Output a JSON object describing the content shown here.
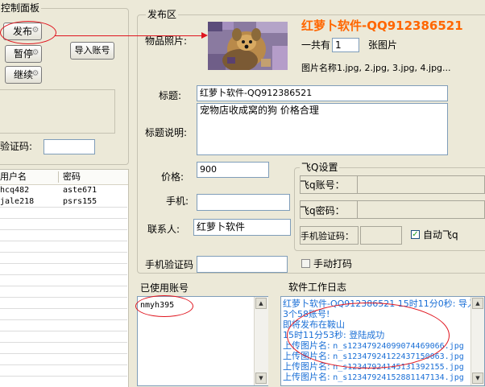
{
  "left_panel": {
    "title": "控制面板",
    "publish_button": "发布",
    "pause_button": "暂停",
    "continue_button": "继续",
    "import_button": "导入账号",
    "captcha_label": "验证码:",
    "captcha_value": ""
  },
  "accounts_table": {
    "headers": [
      "用户名",
      "密码"
    ],
    "rows": [
      {
        "user": "hcq482",
        "pass": "aste671"
      },
      {
        "user": "jale218",
        "pass": "psrs155"
      }
    ]
  },
  "publish": {
    "group_title": "发布区",
    "photo_label": "物品照片:",
    "brand_title": "红萝卜软件-QQ912386521",
    "count_prefix": "一共有",
    "count_value": "1",
    "count_suffix": "张图片",
    "image_names": "图片名称1.jpg, 2.jpg, 3.jpg, 4.jpg...",
    "title_label": "标题:",
    "title_value": "红萝卜软件-QQ912386521",
    "desc_label": "标题说明:",
    "desc_value": "宠物店收成窝的狗 价格合理",
    "price_label": "价格:",
    "price_value": "900",
    "phone_label": "手机:",
    "phone_value": "",
    "contact_label": "联系人:",
    "contact_value": "红萝卜软件",
    "phone_captcha_label": "手机验证码",
    "phone_captcha_value": ""
  },
  "feiq": {
    "group_title": "飞Q设置",
    "account_label": "飞q账号：",
    "password_label": "飞q密码：",
    "phone_captcha_label": "手机验证码：",
    "auto_label": "自动飞q",
    "auto_checked": true,
    "manual_label": "手动打码",
    "manual_checked": false
  },
  "used_accounts": {
    "title": "已使用账号",
    "entries": [
      "nmyh395"
    ]
  },
  "log": {
    "title": "软件工作日志",
    "lines": [
      {
        "text": "红萝卜软件-QQ912386521 15时11分0秒: 导入",
        "mono": ""
      },
      {
        "text": "3个58账号!",
        "mono": ""
      },
      {
        "text": "即将发布在鞍山",
        "mono": ""
      },
      {
        "text": "15时11分53秒: 登陆成功",
        "mono": ""
      },
      {
        "text": "上传图片名: ",
        "mono": "n_s12347924099074469066.jpg"
      },
      {
        "text": "上传图片名: ",
        "mono": "n_s12347924122437150063.jpg"
      },
      {
        "text": "上传图片名: ",
        "mono": "n_s12347924145131392155.jpg"
      },
      {
        "text": "上传图片名: ",
        "mono": "n_s12347924152881147134.jpg"
      }
    ]
  },
  "colors": {
    "window_bg": "#ece9d8",
    "brand": "#ff6600",
    "log_text": "#1a6fd6",
    "annotation": "#e0141e"
  }
}
